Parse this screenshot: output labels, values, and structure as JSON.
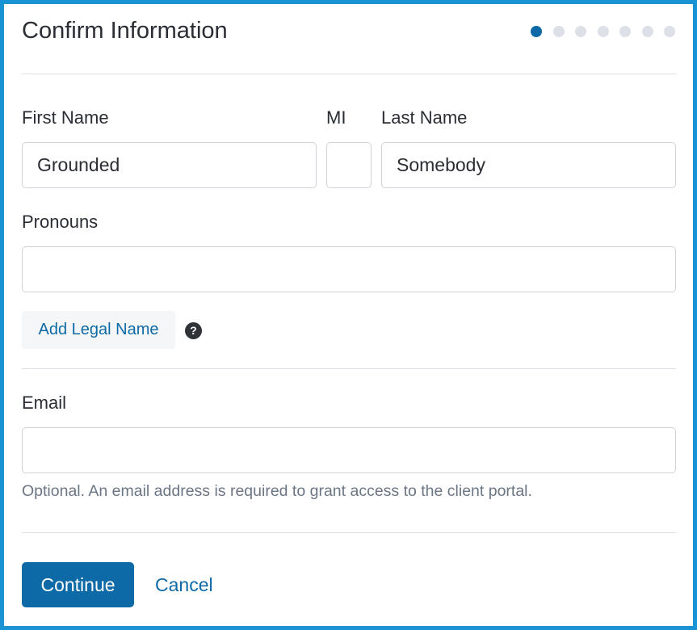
{
  "header": {
    "title": "Confirm Information",
    "steps_total": 7,
    "steps_active": 1
  },
  "form": {
    "first_name": {
      "label": "First Name",
      "value": "Grounded"
    },
    "middle_initial": {
      "label": "MI",
      "value": ""
    },
    "last_name": {
      "label": "Last Name",
      "value": "Somebody"
    },
    "pronouns": {
      "label": "Pronouns",
      "value": ""
    },
    "add_legal_name_label": "Add Legal Name",
    "help_icon_glyph": "?",
    "email": {
      "label": "Email",
      "value": "",
      "hint": "Optional. An email address is required to grant access to the client portal."
    }
  },
  "actions": {
    "continue_label": "Continue",
    "cancel_label": "Cancel"
  },
  "colors": {
    "frame_border": "#1a93d4",
    "primary": "#0e6aa6",
    "dot_inactive": "#dde1e7",
    "text": "#2a2d33",
    "hint_text": "#6b7685"
  },
  "icons": {
    "help": "question-circle-icon"
  }
}
